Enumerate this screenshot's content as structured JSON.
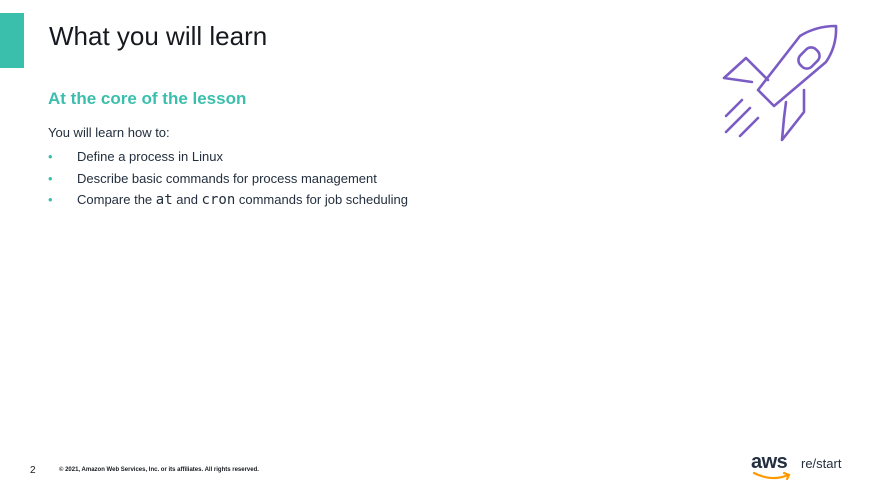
{
  "slide": {
    "title": "What you will learn",
    "subtitle": "At the core of the lesson",
    "intro": "You will learn how to:",
    "bullets": [
      {
        "text": "Define a process in Linux"
      },
      {
        "text": "Describe basic commands for process management"
      },
      {
        "pre": "Compare the ",
        "code1": "at",
        "mid": " and ",
        "code2": "cron",
        "post": " commands for job scheduling"
      }
    ],
    "bullet_glyph": "•"
  },
  "footer": {
    "page_number": "2",
    "copyright": "© 2021, Amazon Web Services, Inc. or its affiliates. All rights reserved.",
    "logo_word": "aws",
    "logo_suffix": "re/start"
  },
  "colors": {
    "accent": "#3bbfad",
    "rocket": "#7b5cc4",
    "aws_orange": "#ff9900",
    "text": "#232f3e"
  },
  "icons": {
    "rocket": "rocket-icon"
  }
}
